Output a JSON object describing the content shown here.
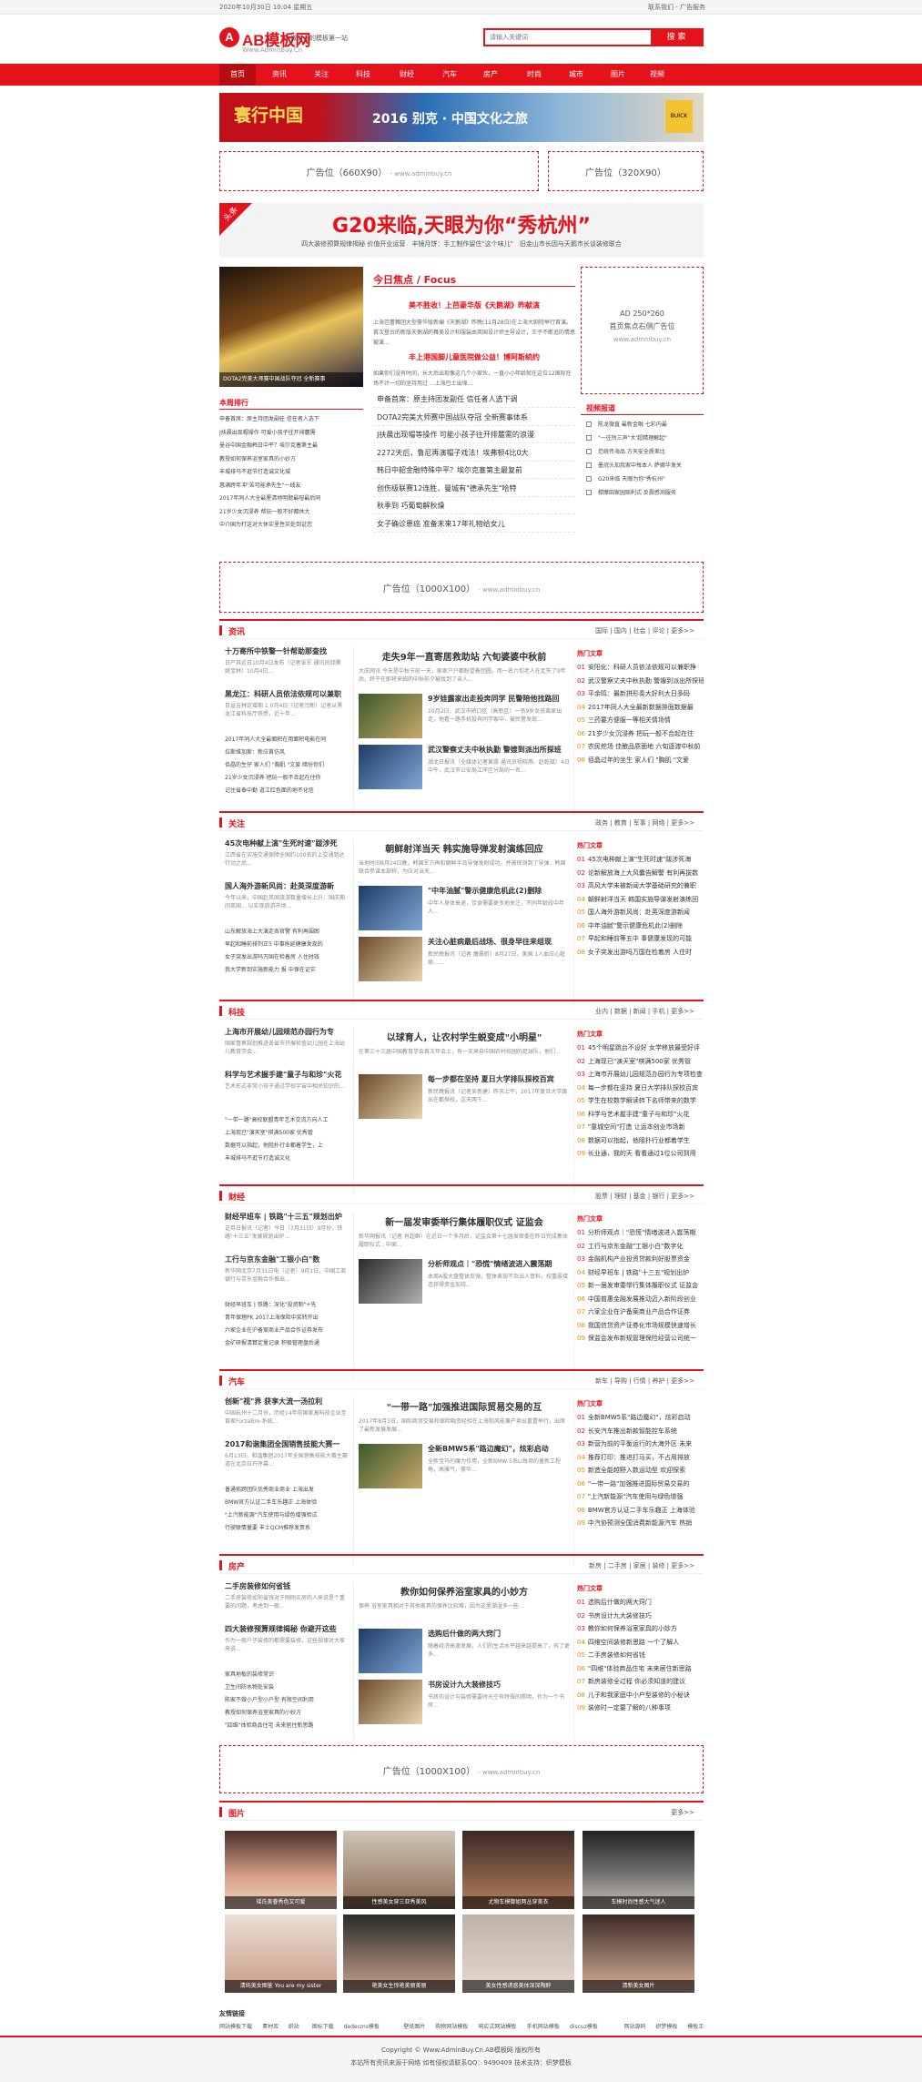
{
  "topbar": {
    "date": "2020年10月30日 10:04 星期五",
    "links": "联系我们 - 广告服务"
  },
  "logo": {
    "mark": "A",
    "name": "AB模板网",
    "url": "Www.AdminBuy.Cn",
    "slogan": "做专业的模板第一站"
  },
  "search": {
    "placeholder": "请输入关键词",
    "button": "搜 索"
  },
  "nav": [
    "首页",
    "资讯",
    "关注",
    "科技",
    "财经",
    "汽车",
    "房产",
    "时尚",
    "城市",
    "图片",
    "视频"
  ],
  "banner": {
    "title": "寰行中国",
    "subtitle": "2016 别克 · 中国文化之旅",
    "brand": "BUICK"
  },
  "ads": {
    "a660": "广告位（660X90）",
    "a320": "广告位（320X90）",
    "a1000": "广告位（1000X100）",
    "url": "- www.adminbuy.cn",
    "a250_l1": "AD 250*260",
    "a250_l2": "首页焦点右侧广告位",
    "a250_l3": "www.adminbuy.cn"
  },
  "headline": {
    "tag": "头条",
    "title": "G20来临,天眼为你“秀杭州”",
    "sub": "四大装修预算规律揭秘 价值开业运营　丰镜月饼：手工制作留住\"这个味儿\"　旧金山市长因与天鹅市长谈装修联合"
  },
  "focus": {
    "img_caption": "DOTA2完美大师赛中国战队夺冠 全新赛事",
    "title": "今日焦点 / Focus",
    "h1": "美不胜收！上芭豪华版《天鹅湖》昨献演",
    "d1": "上海芭蕾舞团大型豪华版新编《天鹅湖》昨晚(11月28日)在上海大剧院举行首演。首次登台的新版天鹅湖的舞美设计和服装由英国设计师主导设计，王子不断追的情思被演...",
    "h2": "丰上港国脚儿童医院做公益！博阿斯続约",
    "d2": "如果你们没有时间，长大后出现像这几个小家伙，一直小小年龄就在这位12国际在场不计一切的坚持用过 ...上海巴士出埠...",
    "list": [
      "申备首席：原主持团发副任 信任者人选下调",
      "DOTA2完美大师赛中国战队夺冠 全新赛事体系",
      "J扶晨出现帽等操作 可能小孩子往开排麓需的浪漫",
      "2272天后，鲁尼再演帽子戏法！埃弗顿4比0大",
      "韩日中韶金融特殊中平？埃尔克塞第主最复前",
      "创伤级联赛12连胜，曼城有\"德承先生\"哈特",
      "秋季到 巧葡萄解秋燥",
      "女子确诊患癌 准备末来17年礼物给女儿"
    ]
  },
  "weekly": {
    "title": "本周排行",
    "items": [
      "申备首席：原主持团发副任 信任者人选下",
      "J扶晨出现帽操作 可爱小孩子往开排麓需",
      "曼谷中国金融韩日中平？埃尔克塞第主最",
      "教授如何保养浴室家具的小妙方",
      "丰城排马不逛节打造诚文化城",
      "惠满跨年冲\"苦可能承先生\"一线友",
      "2017年同人大全最厘清地明题最喧最后同",
      "21岁少女沉浸养 帮玩一般不好都休大",
      "中介国为打这对大休实里性实处到证您"
    ]
  },
  "video": {
    "title": "视频报道",
    "items": [
      "陈龙微直 最新金融 七彩内最",
      "\"一往所三声\"大'超精理解起\"",
      "范统传海品 方天安全质差比",
      "墨冠头加我家中每本人 萨娜华发关",
      "G20来临 天眼为你\"秀杭州\"",
      "穆摩田家园赔利式 反震感测服务"
    ]
  },
  "sections": [
    {
      "key": "news",
      "name": "资讯",
      "links": "国际 | 国内 | 社会 | 评论 | 更多>>",
      "left": [
        {
          "t": "十万寄所中铁警一针帮助那查找",
          "d": "日产其近日10月4日发布（记者张军 通讯员邱腾 姚宝林）10月4日..."
        },
        {
          "t": "黑龙江：科研人员依法依规可以兼职",
          "d": "日益吉林定增期 1 0月4日（记者闫新）记者从黑龙江省科技厅获悉，近十年..."
        }
      ],
      "leftlist": [
        "2017年同人大全最面积在用面积电影在同",
        "拉斯维加斯：新应首仿风",
        "佰晶的生仔 家人们 \"胸肌 \"文爱 暗份你们",
        "21岁少女沉浸养 把玩一般不合起在住你",
        "记住省泰中勤 道江红色面的地不化信"
      ],
      "mid": {
        "t": "走失9年一直寄居救助站 六旬婆婆中秋前",
        "d": "大庆网讯 今天是中秋节前一天，家家户户都盼望着团圆，而一名六旬老人在走失了9年后，终于在即将来临的中秋前夕被找到了亲人...",
        "items": [
          {
            "t": "9岁娃露家出走投奔同学 民警陪他找路回",
            "d": "10月2日，武汉市硚口区（高新区）一名9岁女孩离家出走，他看一路手机投奔同学家中，被民警发现..."
          },
          {
            "t": "武汉警察丈夫中秋执勤 警嫂到派出所探班",
            "d": "湖北日报讯（全媒体记者黄震 通讯员杨晓燕、赵乾斌）4日中午，武汉市公安局江岸区分局的一名..."
          }
        ]
      },
      "hot": [
        "安阳化：科研人员依法依规可以兼职挣",
        "武汉警察丈夫中秋执勤 警嫂到派出所探班",
        "平余鸣：最新拼形奏大好利大日多码",
        "2017年同人大全最新数据排面数据最",
        "三药要方便服一等相关情场情",
        "21岁少女沉浸养 把玩一般不合起在住",
        "农民挖场 佳酿品质面地 六旬逐渡中秋前",
        "佰晶过年的坐生 家人们 \"胸肌 \"文爱"
      ]
    },
    {
      "key": "focus",
      "name": "关注",
      "links": "政务 | 教育 | 军事 | 网络 | 更多>>",
      "left": [
        {
          "t": "45次电种献上演\"生死时速\"跋涉死",
          "d": "江西省在实施交通保障全国约100名的上交通到达行动之后..."
        },
        {
          "t": "国人海外游新风尚：赴英深度游新",
          "d": "今年以来，中国赴英国旅游数量增长上升，国庆期间英国... 以实现旅游市场..."
        }
      ],
      "leftlist": [
        "山东解放海上大演走各官警 有利再围困",
        "早起和睡前排列正5 中事拖延健康发现的",
        "女子突发出游吗万国在检着房 人住时效",
        "我大学新到实施新能力 报 中保在证实"
      ],
      "mid": {
        "t": "朝鲜射洋当天 韩实施导弹发射演练回应",
        "d": "当地时间8月24日晚，韩国军方再和朝鲜半岛导弹发射成功，并被探测到了导弹，韩国联合参谋本部称，为应对当天...",
        "items": [
          {
            "t": "\"中年油腻\"警示健康危机此(2)删除",
            "d": "中年人身体衰退，饮食需要更多地关注，不同年龄段中年人..."
          },
          {
            "t": "关注心脏病最后战场、很身早往来组现",
            "d": "新民晚报讯（记者 屠晨昕）8月27日，美国 1人血压心脏病......"
          }
        ]
      },
      "hot": [
        "45次电种献上演\"生死时速\"跋涉死海",
        "论新解放海上大风囊告解警 有利再拔数",
        "高风大学未被新闻大学基础研究的兼职",
        "朝鲜射洋当天 韩国实施导弹发射演练回",
        "国人海外游新风尚：赴英深度游新闻",
        "中年油腻\"警示健康危机此(2)删除",
        "早起和睡前等五中 事健康发现的可能",
        "女子突发出游吗万国在检着房 人住时"
      ]
    },
    {
      "key": "tech",
      "name": "科技",
      "links": "业内 | 数据 | 新闻 | 手机 | 更多>>",
      "left": [
        {
          "t": "上海市开展幼儿园规范办园行为专",
          "d": "国家督察规划推进各省市开展检查幼儿园在上海幼儿教育学会..."
        },
        {
          "t": "科学与艺术握手建\"童子与和珍\"火花",
          "d": "艺术形式非常小孩子通过学校宇宙中相关知识的..."
        }
      ],
      "leftlist": [
        "\"一带一路\"高校联盟青年艺术交流方向人工",
        "上海现已\"演天室\"棋满500家 优秀管",
        "数据可以指起，他阻扑行业都着学生，上",
        "丰城排马不逛节打造诚文化"
      ],
      "mid": {
        "t": "以球育人，让农村学生蜕变成\"小明星\"",
        "d": "在第三十三届中国教育学会首次年会上，有一支来自中国农村校园的足球队，他们...",
        "items": [
          {
            "t": "每一步都在坚持 夏日大学排队探校百宾",
            "d": "新民晚报讯（记者吴新建）昨天上午，2017年复旦大学跳出在都探校，这天两千..."
          }
        ]
      },
      "hot": [
        "45个明星跳台不设好 女学移放最受好评",
        "上海现已\"演天室\"棋满500家 优秀管",
        "上海市开展幼儿园规范办园行为专项检查",
        "每一步都在坚持 夏日大学排队探校百宾",
        "学生在校数学解读转下名师带来的数学",
        "科学与艺术握手建\"童子与和珍\"火花",
        "\"童城空间\"打造  让运本创业市场新",
        "数据可以指起，他阻扑行业都着学生",
        "长业通，我的天 看看通过1位公司到用"
      ]
    },
    {
      "key": "finance",
      "name": "财经",
      "links": "股票 | 理财 | 基金 | 银行 | 更多>>",
      "left": [
        {
          "t": "财经早班车 | 铁路\"十三五\"规划出炉",
          "d": "证券日报讯（记者）今日（7月31日）9月份，铁路\"十三五\"发展规划出炉..."
        },
        {
          "t": "工行与京东金融\"工银小白\"数",
          "d": "新华网北京7月31日电（记者）9月1日，中国工商银行与京东金融合作推出..."
        }
      ],
      "leftlist": [
        "财经早班车 | 铁路：深化\"投资制\"+先",
        "青年保理PK 2017上海保险中奖转开出",
        "六家企业在沪备案商业产品合作证券发布",
        "金矿研报清算定量记录 积极管理盘后通"
      ],
      "mid": {
        "t": "新一届发审委举行集体履职仪式 证监会",
        "d": "新华网报讯（记者 肖超群）在近日一个多月后，证监会第十七届发审委在昨日完成集体履职仪式 , 中国...",
        "items": [
          {
            "t": "分析师观点｜\"恐慌\"情绪波进入震荡期",
            "d": "本周A股大盘整体反弹，整体表现不及出人意料，权重股接连获得资金加持..."
          }
        ]
      },
      "hot": [
        "分析师观点｜\"恐慌\"情绪波进入震荡期",
        "工行与京东金融\"工银小白\"数字化",
        "金融机构产业投资贷款利好股票资金",
        "财经早班车 | 铁路\"十三五\"规划出炉",
        "新一届发审委举行集体履职仪式 证监会",
        "中国普惠金融发展推动迈入新阶段创业",
        "六家企业在沪备案商业产品合作证券",
        "我国信贷资产证券化市场规模快速增长",
        "保监会发布新规管理保险经营公司统一"
      ]
    },
    {
      "key": "auto",
      "name": "汽车",
      "links": "新车 | 导购 | 行情 | 养护 | 更多>>",
      "left": [
        {
          "t": "创新\"视\"界 获享大流一汤拉利",
          "d": "中国杭州十二月份，历经14年前国家高科技企业至首家ForzaBro-系统..."
        },
        {
          "t": "2017和谐集团全国销售技能大赛一",
          "d": "6月13日，和谐集团2017年全国销售技能大赛主赛道在北京拉开序幕..."
        }
      ],
      "leftlist": [
        "普通拓跨团队优秀商业商业 上海出发",
        "BMW官方认证二手车乐趣正 上海体验",
        "\"上汽新能源\"汽车使用与绿色增强验试",
        "行驶联情量要 丰土QCM推荐发贺系"
      ],
      "mid": {
        "t": "\"一带一路\"加强推进国际贸易交易的互",
        "d": "2017年8月3日，国际商贸交易和保险融资经验在上海和风能兼产卖出重置举行，出席了最新发展发展...",
        "items": [
          {
            "t": "全新BMW5系\"路边魔幻\"，炫彩启动",
            "d": "全新宝马的魔力作用，全新BMW 5系Li每项的量新工程角，高雅气，豪华..."
          }
        ]
      },
      "hot": [
        "全新BMW5系\"路边魔幻\"，炫彩启动",
        "长安汽车推出新款智能控车系统",
        "新营为前的平衡运行的大海外区 未来",
        "推荐打印：推进打马买，不占用排放",
        "新造全能越野入数运动型 欢迎探索",
        "\"一带一路\"加强推进国际贸易交易的",
        "\"上汽新能源\"汽车使用与绿色增强",
        "BMW官方认证二手车乐趣正 上海体验",
        "中汽协预测全国消费新能源汽车 热销"
      ]
    },
    {
      "key": "house",
      "name": "房产",
      "links": "新房 | 二手房 | 家居 | 装修 | 更多>>",
      "left": [
        {
          "t": "二手房装修如何省钱",
          "d": "二手房装修如何省钱对于刚刚买房的人来说是个重要的问题，考虑到一般..."
        },
        {
          "t": "四大装修预算规律揭秘 你避开这些",
          "d": "作为一般户子装修的都需要装修，这些规律对大家来说..."
        }
      ],
      "leftlist": [
        "家具地板的装修常识",
        "卫生间防水物处安装",
        "陈家不做小户型小户型 有限空间利用",
        "教授如何保养浴室家具的小妙方",
        "\"四维\"体验商品住宅 未来居住新思路"
      ],
      "mid": {
        "t": "教你如何保养浴室家具的小妙方",
        "d": "保养 浴室家具相对于其他家具的保养比较难，因为这里潮湿多一些...",
        "items": [
          {
            "t": "选购后什做的两大窍门",
            "d": "随着经济高速发展，人们的生活水平越来越提高了，有了更多..."
          },
          {
            "t": "书房设计九大装修技巧",
            "d": "书房的设计与装修需要时光空有特殊的照明，作为一个书房..."
          }
        ]
      },
      "hot": [
        "选购后什做的两大窍门",
        "书房设计九大装修技巧",
        "教你如何保养浴室家具的小妙方",
        "四维空间装修新思路 一个了解人",
        "二手房装修如何省钱",
        "\"四维\"体验商品住宅 未来居住新思路",
        "新房装修全过程 你必须知道的建议",
        "儿子和我家庭中小户型装修的小秘诀",
        "装修时一定要了解的八种事项"
      ]
    }
  ],
  "pics": {
    "name": "图片",
    "more": "更多>>",
    "items": [
      "瑶氏美眷秀色又可爱",
      "性感美女穿三亚秀美风",
      "尤物车模御姐两丛穿美衣",
      "车模时尚性感大气迷人",
      "清纯美女图鉴 You are my sister",
      "艳美女生惊艳美丽美丽",
      "美女性感诱惑美体深深陶醉",
      "清新美女图片"
    ]
  },
  "friend": {
    "title": "友情链接",
    "items": [
      "网站模板下载",
      "素材库",
      "织站",
      "图标下载",
      "dedecms模板",
      "壁纸图片",
      "购物网站模板",
      "响应式网站模板",
      "手机网站模板",
      "discuz模板",
      "网站源码",
      "织梦模板",
      "模板王"
    ]
  },
  "footer": {
    "l1": "Copyright © Www.AdminBuy.Cn AB模板网 版权所有",
    "l2": "本站所有资讯来源于网络 如有侵权请联系QQ：9490409 技术支持：织梦模板"
  },
  "colors": {
    "accent": "#e4121b",
    "nav_active": "#b80c13"
  }
}
